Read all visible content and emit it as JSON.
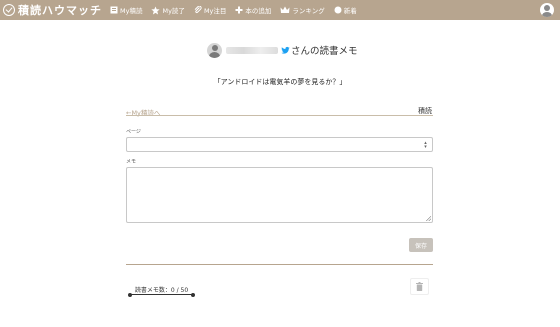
{
  "nav": {
    "brand": "積読ハウマッチ",
    "items": [
      {
        "label": "My積読",
        "icon": "book-icon"
      },
      {
        "label": "My読了",
        "icon": "star-icon"
      },
      {
        "label": "My注目",
        "icon": "paperclip-icon"
      },
      {
        "label": "本の追加",
        "icon": "plus-icon"
      },
      {
        "label": "ランキング",
        "icon": "crown-icon"
      },
      {
        "label": "新着",
        "icon": "circle-icon"
      }
    ],
    "user_icon": "user-avatar-icon"
  },
  "header": {
    "title_suffix": "さんの読書メモ",
    "twitter_icon": "twitter-icon"
  },
  "book": {
    "title": "「アンドロイドは電気羊の夢を見るか？」"
  },
  "breadcrumb": {
    "back_label": "←My積読へ",
    "status": "積読"
  },
  "form": {
    "page_label": "ページ",
    "page_value": "",
    "memo_label": "メモ",
    "memo_value": "",
    "save_label": "保存"
  },
  "footer": {
    "memo_count": "読書メモ数：0 / 50",
    "trash_icon": "trash-icon"
  },
  "colors": {
    "navbar": "#b7a58f",
    "link": "#b7a58f",
    "twitter": "#1da1f2",
    "save_button": "#c7c2bb"
  }
}
